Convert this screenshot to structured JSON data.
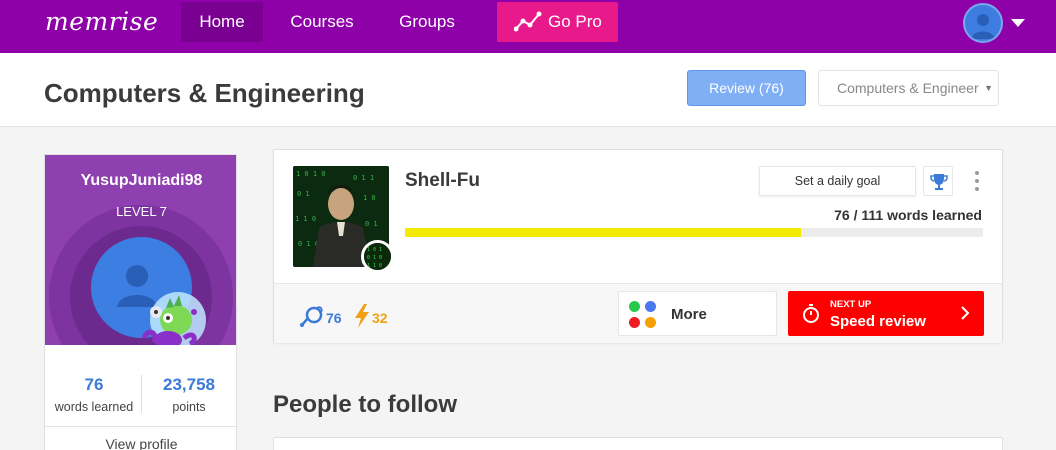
{
  "nav": {
    "logo": "memrise",
    "home": "Home",
    "courses": "Courses",
    "groups": "Groups",
    "gopro": "Go Pro"
  },
  "header": {
    "title": "Computers & Engineering",
    "review_button": "Review (76)",
    "course_select": "Computers & Engineering"
  },
  "profile": {
    "username": "YusupJuniadi98",
    "level": "LEVEL 7",
    "words_count": "76",
    "words_label": "words learned",
    "points_count": "23,758",
    "points_label": "points",
    "view_profile": "View profile"
  },
  "course": {
    "name": "Shell-Fu",
    "daily_goal": "Set a daily goal",
    "words_learned": "76 / 111 words learned",
    "progress": 0.6847,
    "water_count": "76",
    "bolt_count": "32",
    "more_label": "More",
    "next_up": "NEXT UP",
    "speed_review": "Speed review"
  },
  "people": {
    "title": "People to follow"
  },
  "colors": {
    "nav_purple": "#8e00a8",
    "gopro_pink": "#e8198b",
    "review_blue": "#7fb0f5",
    "progress_yellow": "#f2ea00",
    "speed_red": "#ff0000"
  },
  "icons": [
    "user-avatar-icon",
    "caret-down-icon",
    "chart-line-icon",
    "trophy-icon",
    "kebab-menu-icon",
    "watering-can-icon",
    "lightning-icon",
    "stopwatch-icon",
    "chevron-right-icon"
  ]
}
